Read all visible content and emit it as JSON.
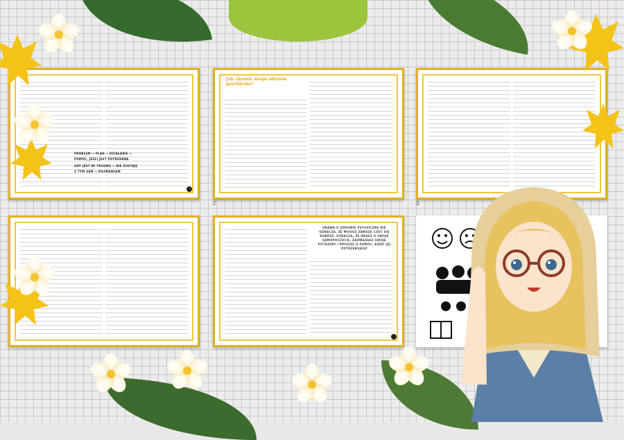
{
  "colors": {
    "accent": "#f0a000",
    "frame": "#e3b022",
    "grid": "#c9c9c9"
  },
  "pages": {
    "p1": {
      "title_lines": [
        "PROBLEM → PLAN → DZIAŁANIE →",
        "POMOC, JEŚLI JEST POTRZEBNA",
        "GDY JEST MI TRUDNO → NIE ZOSTAJĘ",
        "Z TYM SAM → ROZMAWIAM"
      ],
      "number": ""
    },
    "p2": {
      "title": "Jak chronić swoje zdrowie psychiczne?",
      "number": "2"
    },
    "p3": {
      "number": "3"
    },
    "p5": {
      "quote": "OBAWA O ZDROWIE PSYCHICZNE NIE OZNACZA, ŻE MUSISZ ZAWSZE CZUĆ SIĘ DOBRZE. OZNACZA, ŻE DBASZ O SWOJE SAMOPOCZUCIE, ZAUWAŻASZ SWOJE POTRZEBY I PROSISZ O POMOC, KIEDY JEJ POTRZEBUJESZ"
    }
  },
  "icons": [
    "emoji-faces-icon",
    "book-icon",
    "running-person-icon"
  ]
}
